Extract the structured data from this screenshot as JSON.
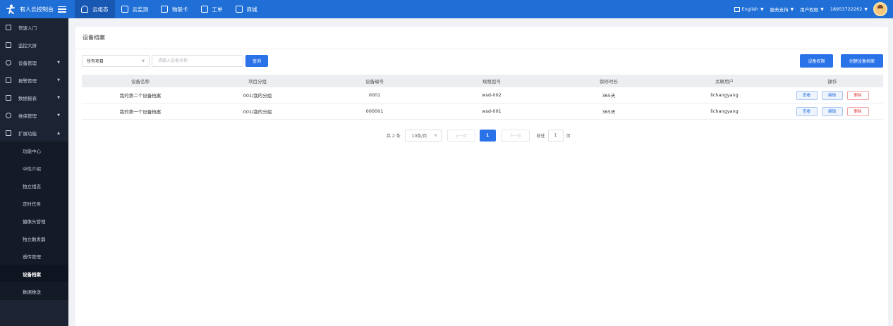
{
  "header": {
    "brand": "有人云控制台",
    "nav": [
      {
        "label": "云组态",
        "icon": "cloud-icon"
      },
      {
        "label": "云监测",
        "icon": "monitor-icon"
      },
      {
        "label": "物联卡",
        "icon": "sim-card-icon"
      },
      {
        "label": "工单",
        "icon": "ticket-icon"
      },
      {
        "label": "商城",
        "icon": "shop-icon"
      }
    ],
    "language": "English",
    "support": "服务支持",
    "permissions": "用户权限",
    "account": "18953722262"
  },
  "sidebar": {
    "items": [
      {
        "label": "快速入门",
        "icon": "home-icon"
      },
      {
        "label": "监控大屏",
        "icon": "screen-icon"
      },
      {
        "label": "设备管理",
        "icon": "device-icon"
      },
      {
        "label": "报警管理",
        "icon": "alarm-icon"
      },
      {
        "label": "数据报表",
        "icon": "report-icon"
      },
      {
        "label": "维保管理",
        "icon": "shield-icon"
      },
      {
        "label": "扩展功能",
        "icon": "grid-icon"
      }
    ],
    "sub_items": [
      "功能中心",
      "中性介绍",
      "独立组态",
      "定时任务",
      "摄像头管理",
      "独立触发器",
      "透传管理",
      "设备档案",
      "数据推送"
    ]
  },
  "main": {
    "title": "设备档案",
    "project_select": "所有项目",
    "search_placeholder": "请输入设备名称",
    "query_label": "查询",
    "perm_label": "设备权限",
    "create_label": "创建设备档案",
    "columns": [
      "设备名称",
      "项目分组",
      "设备编号",
      "规格型号",
      "保修时长",
      "关联用户",
      "操作"
    ],
    "rows": [
      [
        "我的第二个设备档案",
        "001/我的分组",
        "0001",
        "wsd-002",
        "365天",
        "lichangyang"
      ],
      [
        "我的第一个设备档案",
        "001/我的分组",
        "000001",
        "wsd-001",
        "365天",
        "lichangyang"
      ]
    ],
    "actions": {
      "view": "查看",
      "edit": "编辑",
      "delete": "删除"
    }
  },
  "pagination": {
    "total": "共 2 条",
    "page_size": "10条/页",
    "prev": "上一页",
    "current": "1",
    "next": "下一页",
    "goto_prefix": "前往",
    "goto_value": "1",
    "goto_suffix": "页"
  },
  "colors": {
    "topbar": "#1f6fd6",
    "sidebar": "#1c2433",
    "primary": "#2a72e8",
    "danger": "#e04444"
  }
}
